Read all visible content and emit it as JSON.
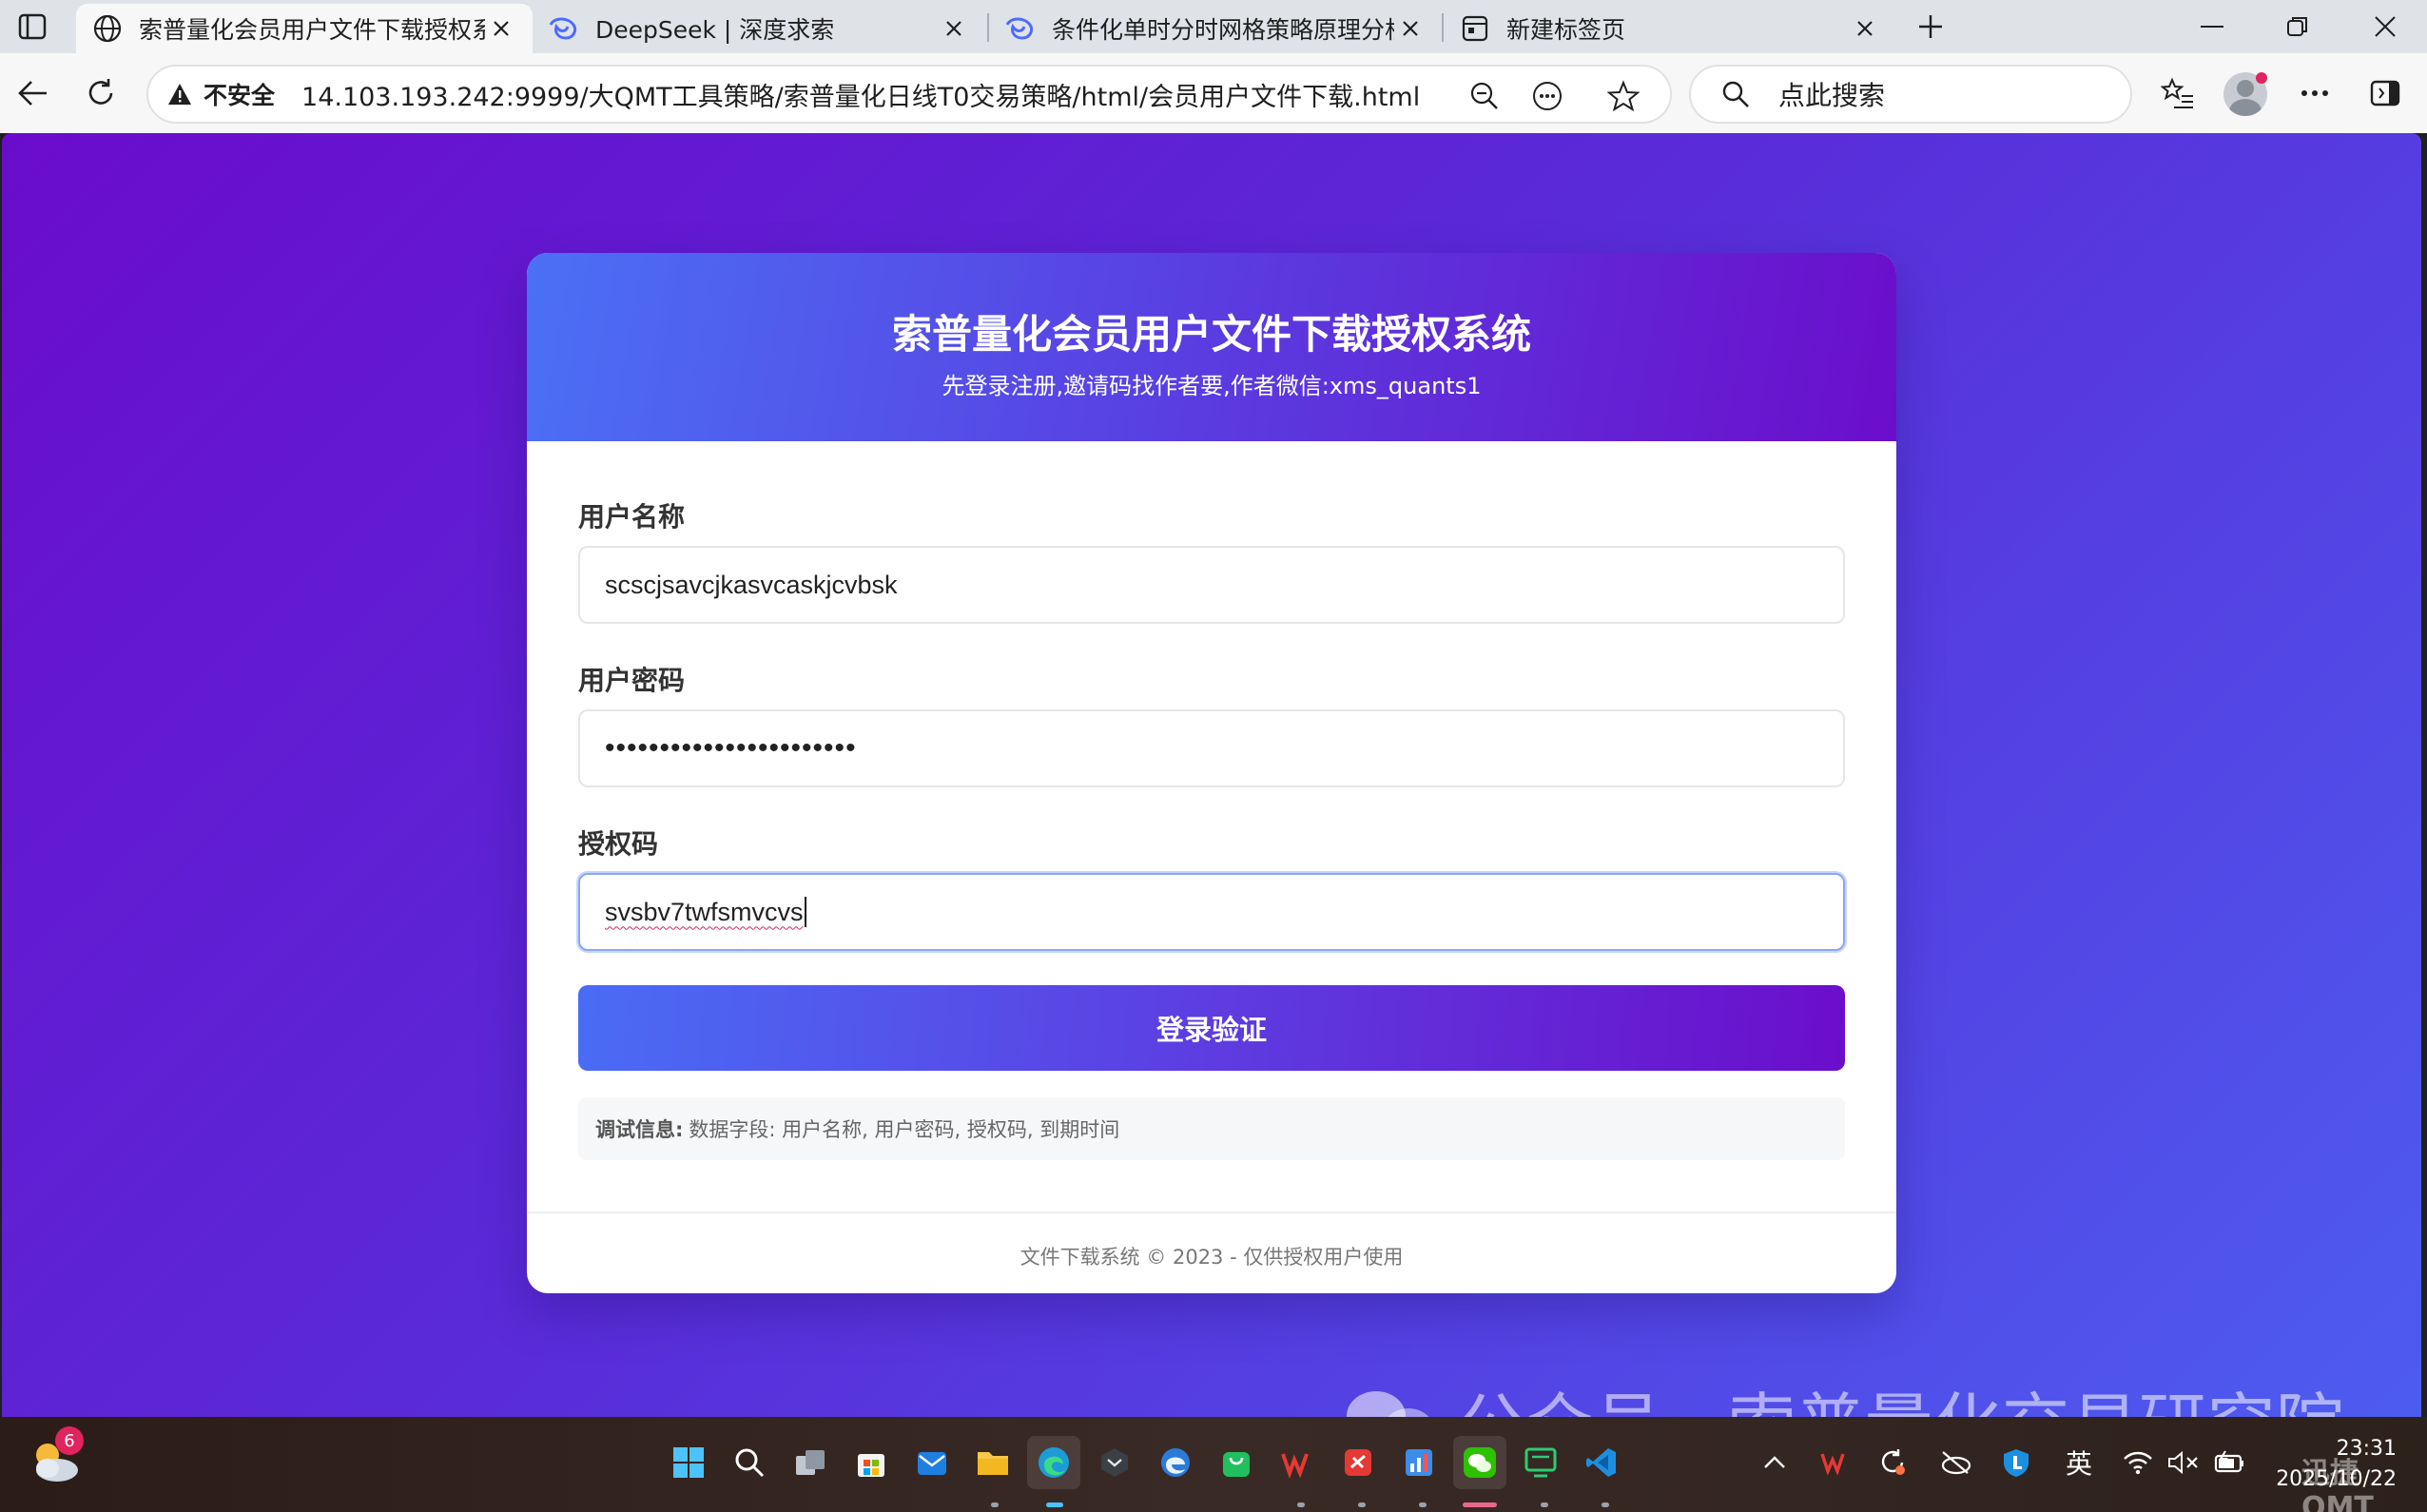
{
  "browser": {
    "tabs": [
      {
        "title": "索普量化会员用户文件下载授权系",
        "active": true
      },
      {
        "title": "DeepSeek | 深度求索",
        "active": false
      },
      {
        "title": "条件化单时分时网格策略原理分析",
        "active": false
      },
      {
        "title": "新建标签页",
        "active": false
      }
    ],
    "security_label": "不安全",
    "url": "14.103.193.242:9999/大QMT工具策略/索普量化日线T0交易策略/html/会员用户文件下载.html",
    "search_placeholder": "点此搜索"
  },
  "page": {
    "title": "索普量化会员用户文件下载授权系统",
    "subtitle": "先登录注册,邀请码找作者要,作者微信:xms_quants1",
    "fields": {
      "username": {
        "label": "用户名称",
        "value": "scscjsavcjkasvcaskjcvbsk"
      },
      "password": {
        "label": "用户密码",
        "value": "•••••••••••••••••••••••"
      },
      "auth_code": {
        "label": "授权码",
        "value": "svsbv7twfsmvcvs"
      }
    },
    "submit_label": "登录验证",
    "debug_label": "调试信息:",
    "debug_text": "数据字段: 用户名称, 用户密码, 授权码, 到期时间",
    "footer": "文件下载系统 © 2023 - 仅供授权用户使用"
  },
  "watermark": {
    "text": "公众号 · 索普量化交易研究院",
    "taskbar_text": "迅捷QMT"
  },
  "taskbar": {
    "weather_badge": "6",
    "ime_label": "英",
    "time": "23:31",
    "date": "2025/10/22"
  },
  "colors": {
    "gradient_start": "#6a0ccc",
    "gradient_end": "#4d5cf0",
    "header_start": "#4b70f5",
    "header_end": "#6b0ecb"
  }
}
